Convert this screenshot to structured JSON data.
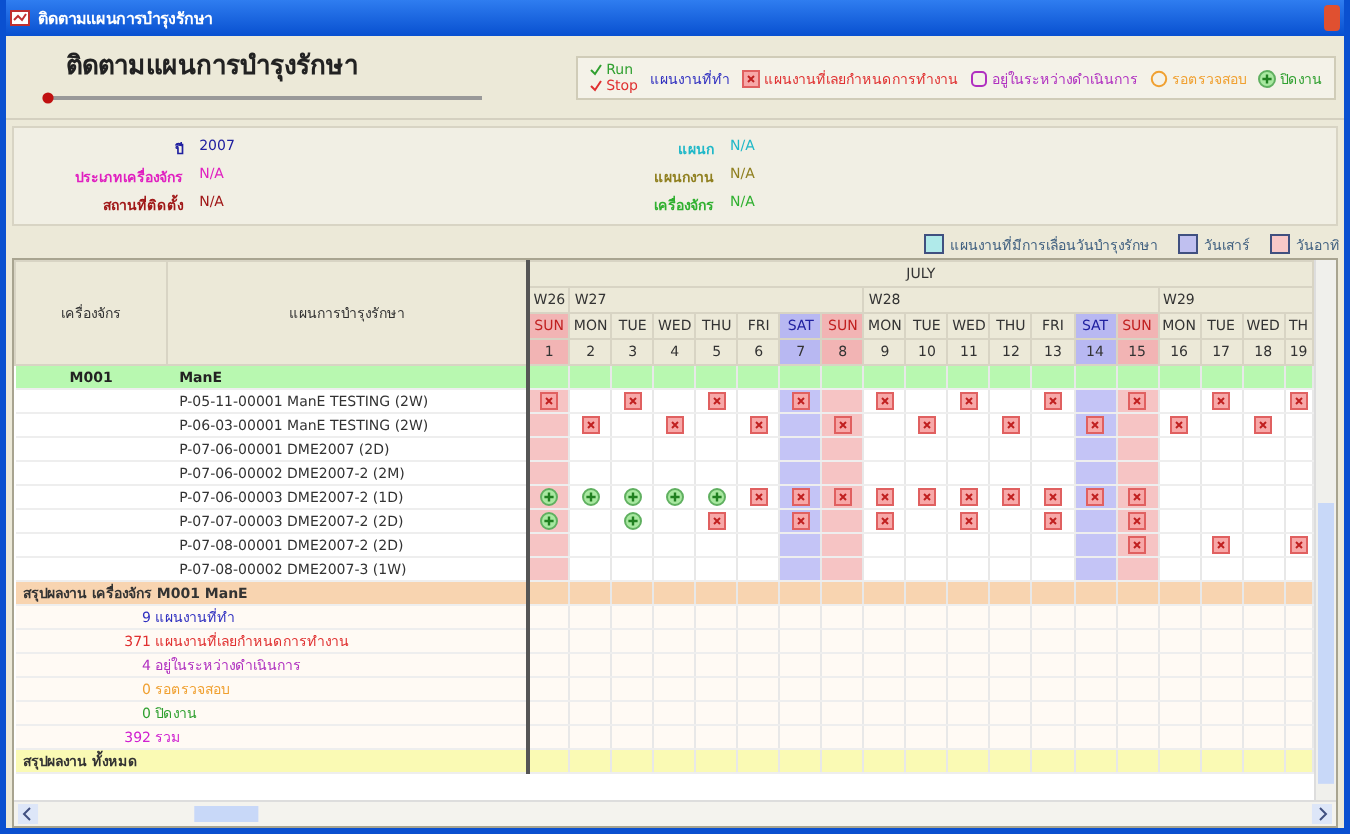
{
  "window": {
    "title": "ติดตามแผนการบำรุงรักษา"
  },
  "header": {
    "title": "ติดตามแผนการบำรุงรักษา",
    "run_label": "Run",
    "stop_label": "Stop",
    "legend": [
      {
        "kind": "text",
        "label": "แผนงานที่ทำ",
        "color": "#3030c0"
      },
      {
        "kind": "late",
        "label": "แผนงานที่เลยกำหนดการทำงาน",
        "color": "#e03030"
      },
      {
        "kind": "progress",
        "label": "อยู่ในระหว่างดำเนินการ",
        "color": "#b030c0"
      },
      {
        "kind": "waiting",
        "label": "รอตรวจสอบ",
        "color": "#f0a030"
      },
      {
        "kind": "done",
        "label": "ปิดงาน",
        "color": "#30a030"
      }
    ]
  },
  "filters": {
    "left": [
      {
        "label": "ปี",
        "value": "2007",
        "color": "#2020a0"
      },
      {
        "label": "ประเภทเครื่องจักร",
        "value": "N/A",
        "color": "#e020c0"
      },
      {
        "label": "สถานที่ติดตั้ง",
        "value": "N/A",
        "color": "#a01818"
      }
    ],
    "right": [
      {
        "label": "แผนก",
        "value": "N/A",
        "color": "#20b8c8"
      },
      {
        "label": "แผนกงาน",
        "value": "N/A",
        "color": "#908020"
      },
      {
        "label": "เครื่องจักร",
        "value": "N/A",
        "color": "#30b030"
      }
    ]
  },
  "options": [
    {
      "label": "แผนงานที่มีการเลื่อนวันบำรุงรักษา",
      "checked": false,
      "color": "#b0eaea"
    },
    {
      "label": "วันเสาร์",
      "checked": false,
      "color": "#c0c0f0"
    },
    {
      "label": "วันอาทิ",
      "checked": false,
      "color": "#f8c8c8"
    }
  ],
  "grid": {
    "columns": [
      "เครื่องจักร",
      "แผนการบำรุงรักษา"
    ],
    "month": "JULY",
    "weeks": [
      {
        "label": "W26",
        "days": [
          {
            "name": "SUN",
            "date": "1",
            "kind": "sun"
          }
        ]
      },
      {
        "label": "W27",
        "days": [
          {
            "name": "MON",
            "date": "2",
            "kind": "weekday"
          },
          {
            "name": "TUE",
            "date": "3",
            "kind": "weekday"
          },
          {
            "name": "WED",
            "date": "4",
            "kind": "weekday"
          },
          {
            "name": "THU",
            "date": "5",
            "kind": "weekday"
          },
          {
            "name": "FRI",
            "date": "6",
            "kind": "weekday"
          },
          {
            "name": "SAT",
            "date": "7",
            "kind": "sat"
          },
          {
            "name": "SUN",
            "date": "8",
            "kind": "sun"
          }
        ]
      },
      {
        "label": "W28",
        "days": [
          {
            "name": "MON",
            "date": "9",
            "kind": "weekday"
          },
          {
            "name": "TUE",
            "date": "10",
            "kind": "weekday"
          },
          {
            "name": "WED",
            "date": "11",
            "kind": "weekday"
          },
          {
            "name": "THU",
            "date": "12",
            "kind": "weekday"
          },
          {
            "name": "FRI",
            "date": "13",
            "kind": "weekday"
          },
          {
            "name": "SAT",
            "date": "14",
            "kind": "sat"
          },
          {
            "name": "SUN",
            "date": "15",
            "kind": "sun"
          }
        ]
      },
      {
        "label": "W29",
        "days": [
          {
            "name": "MON",
            "date": "16",
            "kind": "weekday"
          },
          {
            "name": "TUE",
            "date": "17",
            "kind": "weekday"
          },
          {
            "name": "WED",
            "date": "18",
            "kind": "weekday"
          },
          {
            "name": "TH",
            "date": "19",
            "kind": "weekday"
          }
        ]
      }
    ]
  },
  "machines": [
    {
      "code": "M001",
      "name": "ManE",
      "plans": [
        {
          "name": "P-05-11-00001 ManE TESTING (2W)",
          "marks": [
            {
              "late": true,
              "done": false
            },
            {
              "late": false,
              "done": false
            },
            {
              "late": true,
              "done": false
            },
            {
              "late": false,
              "done": false
            },
            {
              "late": true,
              "done": false
            },
            {
              "late": false,
              "done": false
            },
            {
              "late": true,
              "done": false
            },
            {
              "late": false,
              "done": false
            },
            {
              "late": true,
              "done": false
            },
            {
              "late": false,
              "done": false
            },
            {
              "late": true,
              "done": false
            },
            {
              "late": false,
              "done": false
            },
            {
              "late": true,
              "done": false
            },
            {
              "late": false,
              "done": false
            },
            {
              "late": true,
              "done": false
            },
            {
              "late": false,
              "done": false
            },
            {
              "late": true,
              "done": false
            },
            {
              "late": false,
              "done": false
            },
            {
              "late": true,
              "done": false
            }
          ]
        },
        {
          "name": "P-06-03-00001 ManE TESTING (2W)",
          "marks": [
            {
              "late": false,
              "done": false
            },
            {
              "late": true,
              "done": false
            },
            {
              "late": false,
              "done": false
            },
            {
              "late": true,
              "done": false
            },
            {
              "late": false,
              "done": false
            },
            {
              "late": true,
              "done": false
            },
            {
              "late": false,
              "done": false
            },
            {
              "late": true,
              "done": false
            },
            {
              "late": false,
              "done": false
            },
            {
              "late": true,
              "done": false
            },
            {
              "late": false,
              "done": false
            },
            {
              "late": true,
              "done": false
            },
            {
              "late": false,
              "done": false
            },
            {
              "late": true,
              "done": false
            },
            {
              "late": false,
              "done": false
            },
            {
              "late": true,
              "done": false
            },
            {
              "late": false,
              "done": false
            },
            {
              "late": true,
              "done": false
            },
            {
              "late": false,
              "done": false
            }
          ]
        },
        {
          "name": "P-07-06-00001 DME2007 (2D)"
        },
        {
          "name": "P-07-06-00002 DME2007-2 (2M)"
        },
        {
          "name": "P-07-06-00003 DME2007-2 (1D)",
          "marks": [
            {
              "late": false,
              "done": true
            },
            {
              "late": false,
              "done": true
            },
            {
              "late": false,
              "done": true
            },
            {
              "late": false,
              "done": true
            },
            {
              "late": false,
              "done": true
            },
            {
              "late": true,
              "done": false
            },
            {
              "late": true,
              "done": false
            },
            {
              "late": true,
              "done": false
            },
            {
              "late": true,
              "done": false
            },
            {
              "late": true,
              "done": false
            },
            {
              "late": true,
              "done": false
            },
            {
              "late": true,
              "done": false
            },
            {
              "late": true,
              "done": false
            },
            {
              "late": true,
              "done": false
            },
            {
              "late": true,
              "done": false
            },
            {
              "late": false,
              "done": false
            },
            {
              "late": false,
              "done": false
            },
            {
              "late": false,
              "done": false
            },
            {
              "late": false,
              "done": false
            }
          ]
        },
        {
          "name": "P-07-07-00003 DME2007-2 (2D)",
          "marks": [
            {
              "late": false,
              "done": true
            },
            {
              "late": false,
              "done": false
            },
            {
              "late": false,
              "done": true
            },
            {
              "late": false,
              "done": false
            },
            {
              "late": true,
              "done": false
            },
            {
              "late": false,
              "done": false
            },
            {
              "late": true,
              "done": false
            },
            {
              "late": false,
              "done": false
            },
            {
              "late": true,
              "done": false
            },
            {
              "late": false,
              "done": false
            },
            {
              "late": true,
              "done": false
            },
            {
              "late": false,
              "done": false
            },
            {
              "late": true,
              "done": false
            },
            {
              "late": false,
              "done": false
            },
            {
              "late": true,
              "done": false
            },
            {
              "late": false,
              "done": false
            },
            {
              "late": false,
              "done": false
            },
            {
              "late": false,
              "done": false
            },
            {
              "late": false,
              "done": false
            }
          ]
        },
        {
          "name": "P-07-08-00001 DME2007-2 (2D)",
          "marks": [
            {
              "late": false,
              "done": false
            },
            {
              "late": false,
              "done": false
            },
            {
              "late": false,
              "done": false
            },
            {
              "late": false,
              "done": false
            },
            {
              "late": false,
              "done": false
            },
            {
              "late": false,
              "done": false
            },
            {
              "late": false,
              "done": false
            },
            {
              "late": false,
              "done": false
            },
            {
              "late": false,
              "done": false
            },
            {
              "late": false,
              "done": false
            },
            {
              "late": false,
              "done": false
            },
            {
              "late": false,
              "done": false
            },
            {
              "late": false,
              "done": false
            },
            {
              "late": false,
              "done": false
            },
            {
              "late": true,
              "done": false
            },
            {
              "late": false,
              "done": false
            },
            {
              "late": true,
              "done": false
            },
            {
              "late": false,
              "done": false
            },
            {
              "late": true,
              "done": false
            }
          ]
        },
        {
          "name": "P-07-08-00002 DME2007-3 (1W)"
        }
      ],
      "summary": {
        "title": "สรุปผลงาน เครื่องจักร M001  ManE",
        "lines": [
          {
            "count": "9",
            "label": "แผนงานที่ทำ",
            "color": "#3030c0"
          },
          {
            "count": "371",
            "label": "แผนงานที่เลยกำหนดการทำงาน",
            "color": "#e03030"
          },
          {
            "count": "4",
            "label": "อยู่ในระหว่างดำเนินการ",
            "color": "#b030c0"
          },
          {
            "count": "0",
            "label": "รอตรวจสอบ",
            "color": "#f0a030"
          },
          {
            "count": "0",
            "label": "ปิดงาน",
            "color": "#30a030"
          },
          {
            "count": "392",
            "label": "รวม",
            "color": "#d020d0"
          }
        ]
      }
    }
  ],
  "total": {
    "title": "สรุปผลงาน ทั้งหมด"
  }
}
